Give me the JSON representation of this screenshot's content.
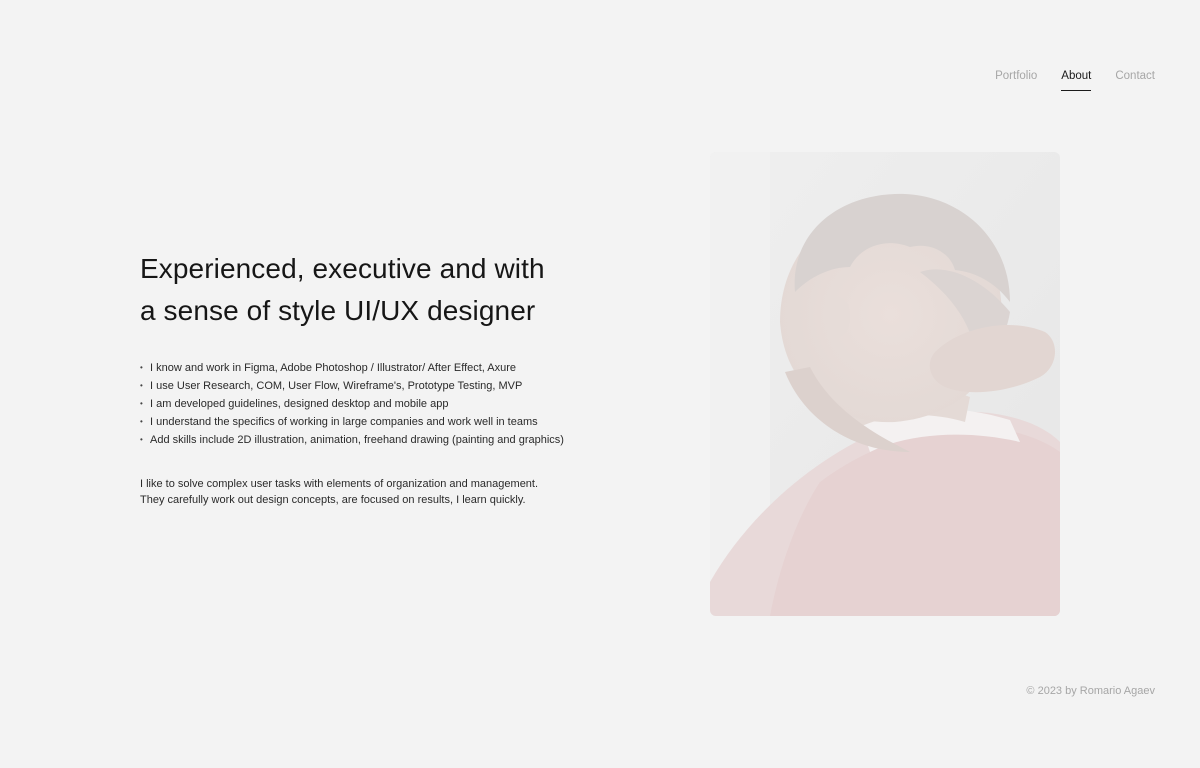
{
  "nav": {
    "items": [
      {
        "label": "Portfolio",
        "active": false
      },
      {
        "label": "About",
        "active": true
      },
      {
        "label": "Contact",
        "active": false
      }
    ]
  },
  "hero": {
    "headline_line1": "Experienced, executive and with",
    "headline_line2": "a sense of style UI/UX designer"
  },
  "skills": [
    "I know and work in Figma, Adobe Photoshop / Illustrator/ After Effect, Axure",
    "I use User Research, COM, User Flow, Wireframe's, Prototype Testing, MVP",
    "I am developed guidelines, designed desktop and mobile app",
    "I understand the specifics of working in large companies and work well in teams",
    "Add skills include 2D illustration, animation, freehand drawing (painting and graphics)"
  ],
  "bio": {
    "line1": "I like to solve complex user tasks with elements of organization and management.",
    "line2": "They carefully work out design concepts, are focused on results, I learn quickly."
  },
  "photo": {
    "icon": "portrait-photo"
  },
  "footer": {
    "copyright": "© 2023 by Romario Agaev"
  },
  "colors": {
    "background": "#f3f3f3",
    "text": "#1a1a1a",
    "muted": "#a6a6a6"
  }
}
